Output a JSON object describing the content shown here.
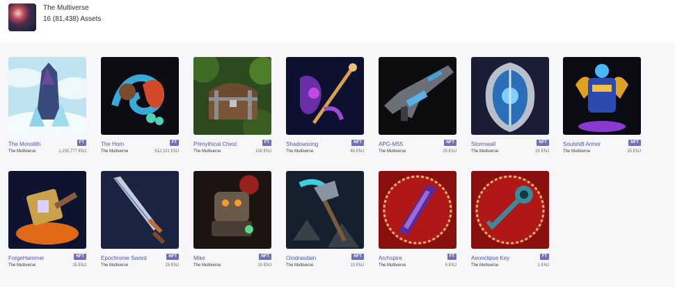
{
  "collection": {
    "title": "The Multiverse",
    "assets_text": "16 (81,438) Assets"
  },
  "items": [
    {
      "name": "The Monolith",
      "badge": "FT",
      "collection": "The Multiverse",
      "supply": "1,155,777 ENJ"
    },
    {
      "name": "The Horn",
      "badge": "FT",
      "collection": "The Multiverse",
      "supply": "512,221 ENJ"
    },
    {
      "name": "Primythical Chest",
      "badge": "FT",
      "collection": "The Multiverse",
      "supply": "100 ENJ"
    },
    {
      "name": "Shadowsong",
      "badge": "NFT",
      "collection": "The Multiverse",
      "supply": "60 ENJ"
    },
    {
      "name": "APG-M55",
      "badge": "NFT",
      "collection": "The Multiverse",
      "supply": "25 ENJ"
    },
    {
      "name": "Stormwall",
      "badge": "NFT",
      "collection": "The Multiverse",
      "supply": "25 ENJ"
    },
    {
      "name": "Soulshift Armor",
      "badge": "NFT",
      "collection": "The Multiverse",
      "supply": "25 ENJ"
    },
    {
      "name": "ForgeHammer",
      "badge": "NFT",
      "collection": "The Multiverse",
      "supply": "25 ENJ"
    },
    {
      "name": "Epochrome Sword",
      "badge": "NFT",
      "collection": "The Multiverse",
      "supply": "15 ENJ"
    },
    {
      "name": "Mike",
      "badge": "NFT",
      "collection": "The Multiverse",
      "supply": "15 ENJ"
    },
    {
      "name": "Oindrasdain",
      "badge": "NFT",
      "collection": "The Multiverse",
      "supply": "10 ENJ"
    },
    {
      "name": "Archspire",
      "badge": "FT",
      "collection": "The Multiverse",
      "supply": "5 ENJ"
    },
    {
      "name": "Aeonclipse Key",
      "badge": "FT",
      "collection": "The Multiverse",
      "supply": "1 ENJ"
    }
  ],
  "colors": {
    "link": "#4a56b8",
    "badge_bg": "#6f72b8",
    "page_bg": "#f7f7f9"
  }
}
